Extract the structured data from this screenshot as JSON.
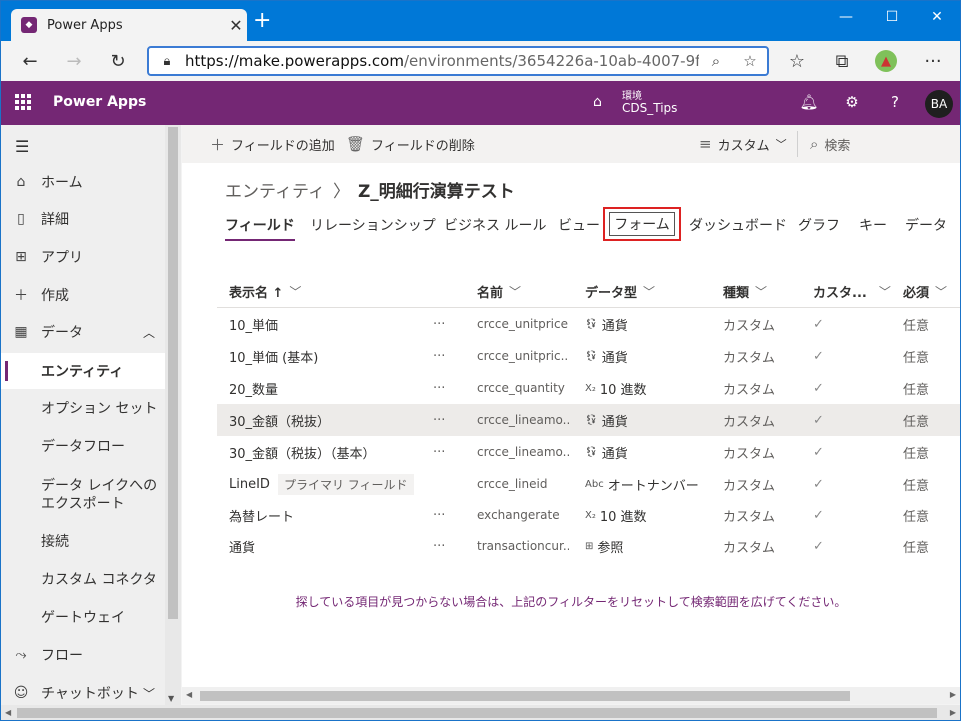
{
  "browser": {
    "tab_title": "Power Apps",
    "url_domain": "https://make.powerapps.com",
    "url_rest": "/environments/3654226a-10ab-4007-9f..."
  },
  "appbar": {
    "app_name": "Power Apps",
    "env_label": "環境",
    "env_name": "CDS_Tips",
    "avatar": "BA"
  },
  "sidebar": {
    "items": [
      {
        "label": "ホーム",
        "icon": "home-icon"
      },
      {
        "label": "詳細",
        "icon": "book-icon"
      },
      {
        "label": "アプリ",
        "icon": "apps-icon"
      },
      {
        "label": "作成",
        "icon": "plus-icon"
      },
      {
        "label": "データ",
        "icon": "table-icon"
      },
      {
        "label": "エンティティ"
      },
      {
        "label": "オプション セット"
      },
      {
        "label": "データフロー"
      },
      {
        "label": "データ レイクへのエクスポート"
      },
      {
        "label": "接続"
      },
      {
        "label": "カスタム コネクタ"
      },
      {
        "label": "ゲートウェイ"
      },
      {
        "label": "フロー",
        "icon": "flow-icon"
      },
      {
        "label": "チャットボット",
        "icon": "bot-icon"
      }
    ]
  },
  "commandbar": {
    "add_field": "フィールドの追加",
    "delete_field": "フィールドの削除",
    "view": "カスタム",
    "search": "検索"
  },
  "breadcrumb": {
    "root": "エンティティ",
    "current": "Z_明細行演算テスト"
  },
  "tabs": [
    "フィールド",
    "リレーションシップ",
    "ビジネス ルール",
    "ビュー",
    "フォーム",
    "ダッシュボード",
    "グラフ",
    "キー",
    "データ"
  ],
  "table": {
    "headers": [
      "表示名 ↑",
      "名前",
      "データ型",
      "種類",
      "カスタ...",
      "必須"
    ],
    "rows": [
      {
        "display": "10_単価",
        "name": "crcce_unitprice",
        "type": "通貨",
        "type_icon": "currency-icon",
        "kind": "カスタム",
        "req": "任意"
      },
      {
        "display": "10_単価 (基本)",
        "name": "crcce_unitpric...",
        "type": "通貨",
        "type_icon": "currency-icon",
        "kind": "カスタム",
        "req": "任意"
      },
      {
        "display": "20_数量",
        "name": "crcce_quantity",
        "type": "10 進数",
        "type_icon": "decimal-icon",
        "kind": "カスタム",
        "req": "任意"
      },
      {
        "display": "30_金額（税抜）",
        "name": "crcce_lineamo...",
        "type": "通貨",
        "type_icon": "currency-icon",
        "kind": "カスタム",
        "req": "任意"
      },
      {
        "display": "30_金額（税抜）（基本）",
        "name": "crcce_lineamo...",
        "type": "通貨",
        "type_icon": "currency-icon",
        "kind": "カスタム",
        "req": "任意"
      },
      {
        "display": "LineID",
        "badge": "プライマリ フィールド",
        "name": "crcce_lineid",
        "type": "オートナンバー",
        "type_icon": "autonumber-icon",
        "kind": "カスタム",
        "req": "任意"
      },
      {
        "display": "為替レート",
        "name": "exchangerate",
        "type": "10 進数",
        "type_icon": "decimal-icon",
        "kind": "カスタム",
        "req": "任意"
      },
      {
        "display": "通貨",
        "name": "transactioncur...",
        "type": "参照",
        "type_icon": "lookup-icon",
        "kind": "カスタム",
        "req": "任意"
      }
    ]
  },
  "note": "探している項目が見つからない場合は、上記のフィルターをリセットして検索範囲を広げてください。",
  "colors": {
    "brand": "#742774",
    "highlight": "#dd2222",
    "titlebar": "#0078d7"
  }
}
